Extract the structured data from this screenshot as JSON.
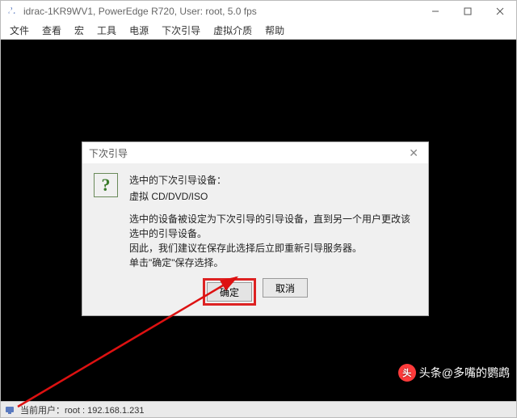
{
  "window": {
    "title": "idrac-1KR9WV1, PowerEdge R720, User: root, 5.0 fps"
  },
  "menubar": {
    "items": [
      "文件",
      "查看",
      "宏",
      "工具",
      "电源",
      "下次引导",
      "虚拟介质",
      "帮助"
    ]
  },
  "dialog": {
    "title": "下次引导",
    "heading": "选中的下次引导设备：",
    "device": "虚拟 CD/DVD/ISO",
    "line1": "选中的设备被设定为下次引导的引导设备，直到另一个用户更改该选中的引导设备。",
    "line2": "因此，我们建议在保存此选择后立即重新引导服务器。",
    "line3": "单击\"确定\"保存选择。",
    "ok": "确定",
    "cancel": "取消"
  },
  "statusbar": {
    "text": "当前用户：root : 192.168.1.231"
  },
  "watermark": {
    "logo": "头",
    "text": "头条@多嘴的鹦鹉"
  }
}
